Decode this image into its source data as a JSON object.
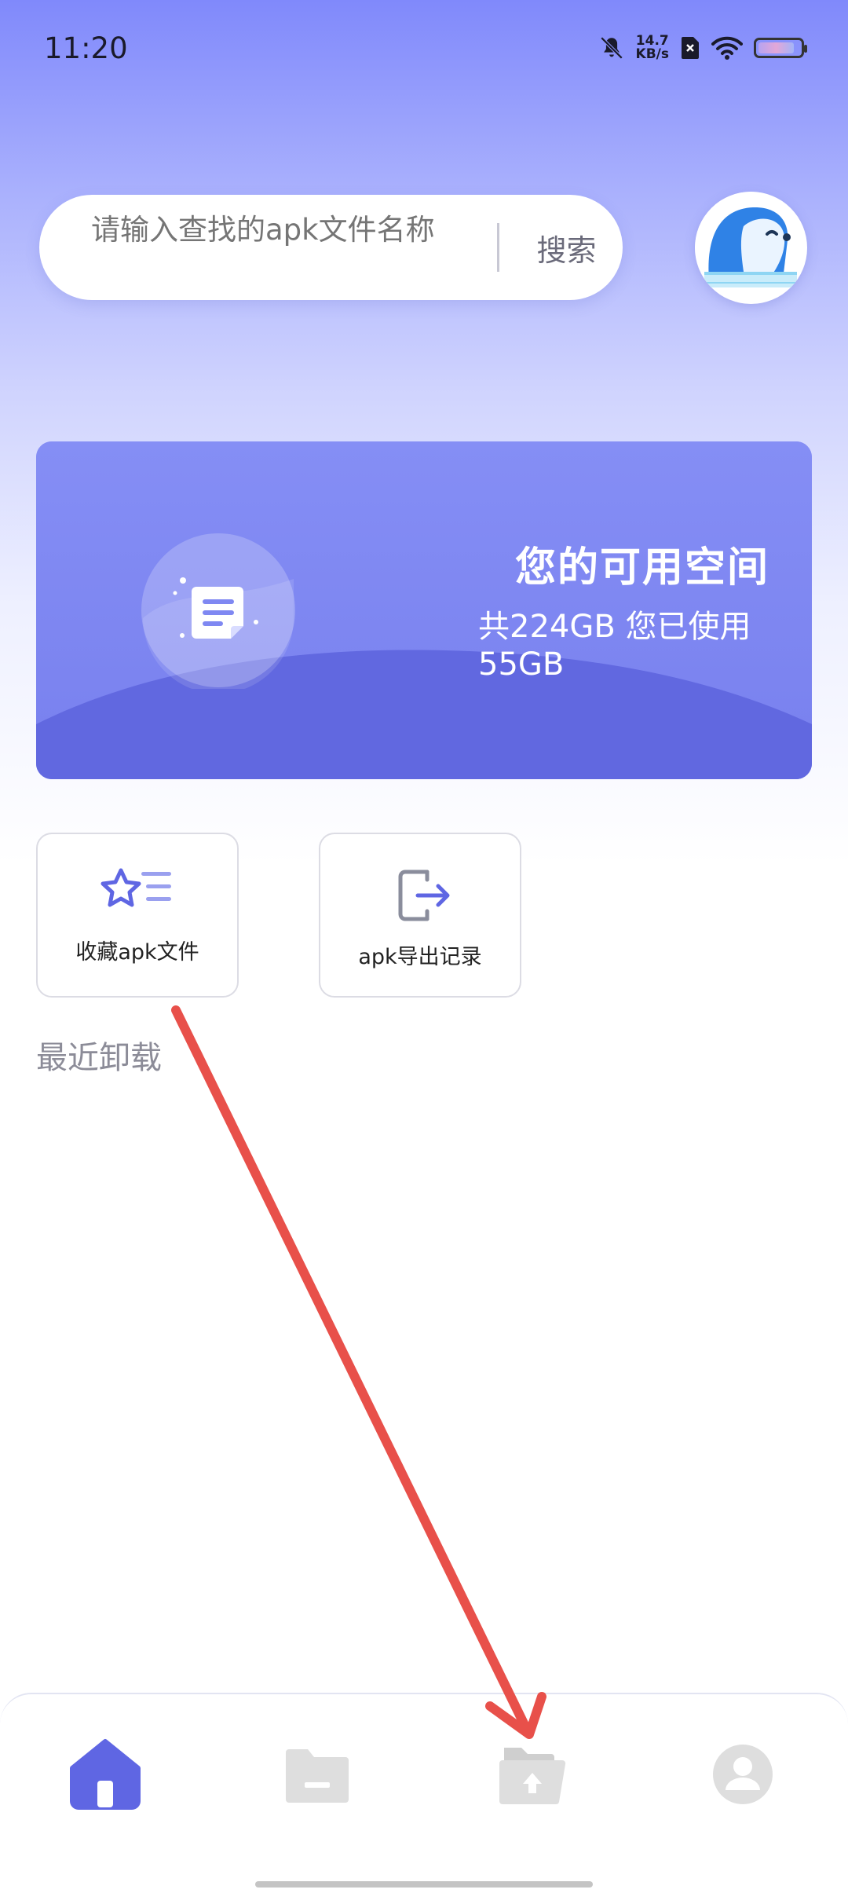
{
  "status_bar": {
    "time": "11:20",
    "net_speed_value": "14.7",
    "net_speed_unit": "KB/s"
  },
  "search": {
    "placeholder": "请输入查找的apk文件名称",
    "button_label": "搜索"
  },
  "storage_card": {
    "title": "您的可用空间",
    "summary": "共224GB 您已使用55GB"
  },
  "actions": [
    {
      "label": "收藏apk文件",
      "icon": "star-list-icon"
    },
    {
      "label": "apk导出记录",
      "icon": "export-icon"
    }
  ],
  "recent_section": {
    "title": "最近卸载"
  },
  "bottom_nav": [
    {
      "icon": "home-icon",
      "active": true
    },
    {
      "icon": "folder-icon",
      "active": false
    },
    {
      "icon": "upload-folder-icon",
      "active": false
    },
    {
      "icon": "profile-icon",
      "active": false
    }
  ],
  "colors": {
    "accent": "#5f66e3",
    "inactive_icon": "#dedede",
    "annotation_arrow": "#e8504a"
  }
}
